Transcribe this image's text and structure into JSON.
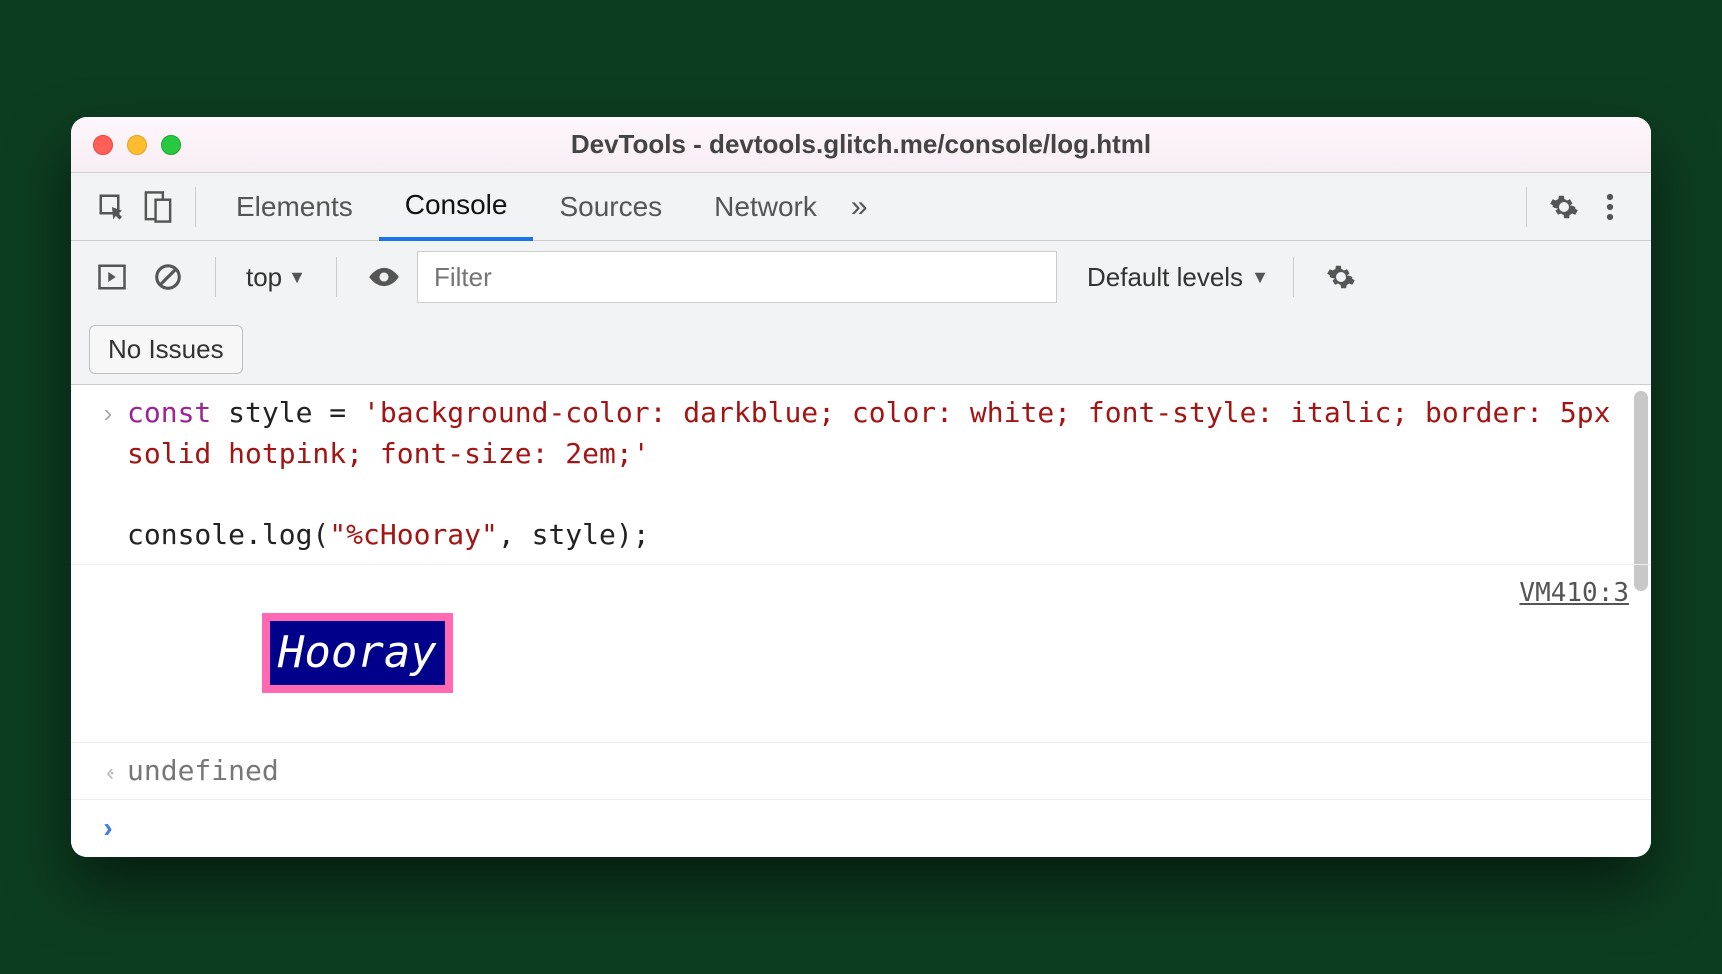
{
  "window": {
    "title": "DevTools - devtools.glitch.me/console/log.html"
  },
  "tabs": {
    "elements": "Elements",
    "console": "Console",
    "sources": "Sources",
    "network": "Network"
  },
  "toolbar": {
    "context": "top",
    "filter_placeholder": "Filter",
    "levels": "Default levels",
    "issues": "No Issues"
  },
  "console": {
    "input_code_html": "<span class='kw'>const</span><span class='txt'> style = </span><span class='str'>'background-color: darkblue; color: white; font-style: italic; border: 5px solid hotpink; font-size: 2em;'</span>\n\n<span class='txt'>console.log(</span><span class='str'>\"%cHooray\"</span><span class='txt'>, style);</span>",
    "styled_output": "Hooray",
    "source_link": "VM410:3",
    "return_value": "undefined"
  }
}
